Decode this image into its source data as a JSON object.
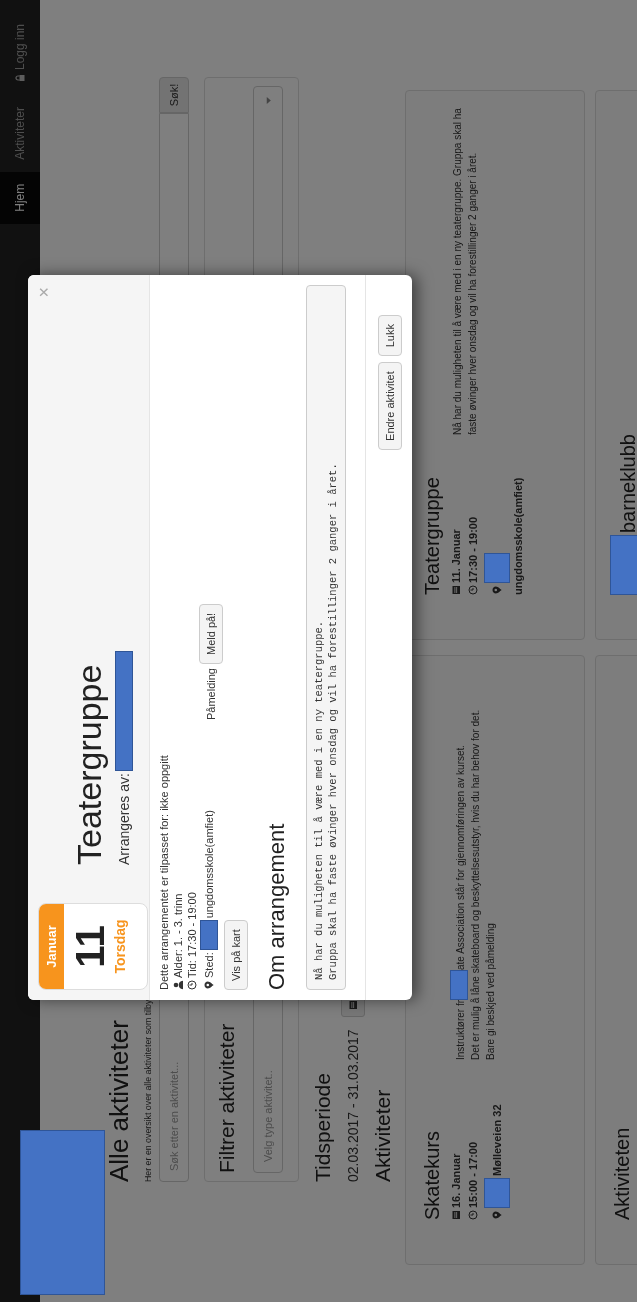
{
  "navbar": {
    "logo_redacted": true,
    "items": [
      {
        "label": "Hjem",
        "selected": true
      },
      {
        "label": "Aktiviteter",
        "selected": false
      },
      {
        "label": "Logg inn",
        "selected": false
      }
    ]
  },
  "page": {
    "title": "Alle aktiviteter",
    "intro": "Her er en oversikt over alle aktiviteter som tilby",
    "search": {
      "placeholder": "Søk etter en aktivitet...",
      "button": "Søk!"
    },
    "filter": {
      "title": "Filtrer aktiviteter",
      "select_placeholder": "Velg type aktivitet.."
    },
    "period": {
      "title": "Tidsperiode",
      "range": "02.03.2017 - 31.03.2017"
    },
    "activities_title": "Aktiviteter",
    "cards": [
      {
        "title": [
          {
            "kind": "text",
            "text": "Skatekurs"
          }
        ],
        "date": "16. Januar",
        "time": "15:00 - 17:00",
        "location": [
          {
            "kind": "redacted"
          },
          {
            "kind": "text",
            "text": "Mølleveien 32"
          }
        ],
        "description": [
          [
            {
              "kind": "text",
              "text": "Instruktører fr"
            },
            {
              "kind": "redacted"
            },
            {
              "kind": "text",
              "text": "ate Association står for gjennomføringen av kurset."
            }
          ],
          [
            {
              "kind": "text",
              "text": "Det er mulig å låne skateboard og beskyttelsesutstyr, hvis du har behov for det."
            }
          ],
          [
            {
              "kind": "text",
              "text": "Bare gi beskjed ved påmelding"
            }
          ]
        ]
      },
      {
        "title": [
          {
            "kind": "text",
            "text": "Teatergruppe"
          }
        ],
        "date": "11. Januar",
        "time": "17:30 - 19:00",
        "location": [
          {
            "kind": "redacted"
          },
          {
            "kind": "text",
            "text": "ungdomsskole(amfiet)"
          }
        ],
        "description": [
          [
            {
              "kind": "text",
              "text": "Nå har du muligheten til å være med i en ny teatergruppe. Gruppa skal ha"
            }
          ],
          [
            {
              "kind": "text",
              "text": "faste øvinger hver onsdag og vil ha forestillinger 2 ganger i året."
            }
          ]
        ]
      },
      {
        "title": [
          {
            "kind": "text",
            "text": "Aktiviteten"
          }
        ]
      },
      {
        "title": [
          {
            "kind": "redacted"
          },
          {
            "kind": "text",
            "text": "barneklubb"
          }
        ]
      }
    ]
  },
  "modal": {
    "month": "Januar",
    "day": "11",
    "weekday": "Torsdag",
    "title": "Teatergruppe",
    "organizer": [
      {
        "kind": "text",
        "text": "Arrangeres av:"
      },
      {
        "kind": "redacted"
      }
    ],
    "close": "×",
    "suited": "Dette arrangementet er tilpasset for: ikke oppgitt",
    "details": [
      {
        "segments": [
          {
            "kind": "text",
            "text": "Alder: 1. - 3. trinn"
          }
        ]
      },
      {
        "segments": [
          {
            "kind": "text",
            "text": "Tid: 17:30 - 19:00"
          }
        ]
      },
      {
        "segments": [
          {
            "kind": "text",
            "text": "Sted:"
          },
          {
            "kind": "redacted"
          },
          {
            "kind": "text",
            "text": "ungdomsskole(amfiet)"
          }
        ]
      }
    ],
    "map_button": "Vis på kart",
    "signup_label": "Påmelding",
    "signup_button": "Meld på!",
    "about_title": "Om arrangement",
    "about_text": [
      "Nå har du muligheten til å være med i en ny teatergruppe.",
      "Gruppa skal ha faste øvinger hver onsdag og vil ha forestillinger 2 ganger i året."
    ],
    "buttons": [
      "Endre aktivitet",
      "Lukk"
    ]
  }
}
